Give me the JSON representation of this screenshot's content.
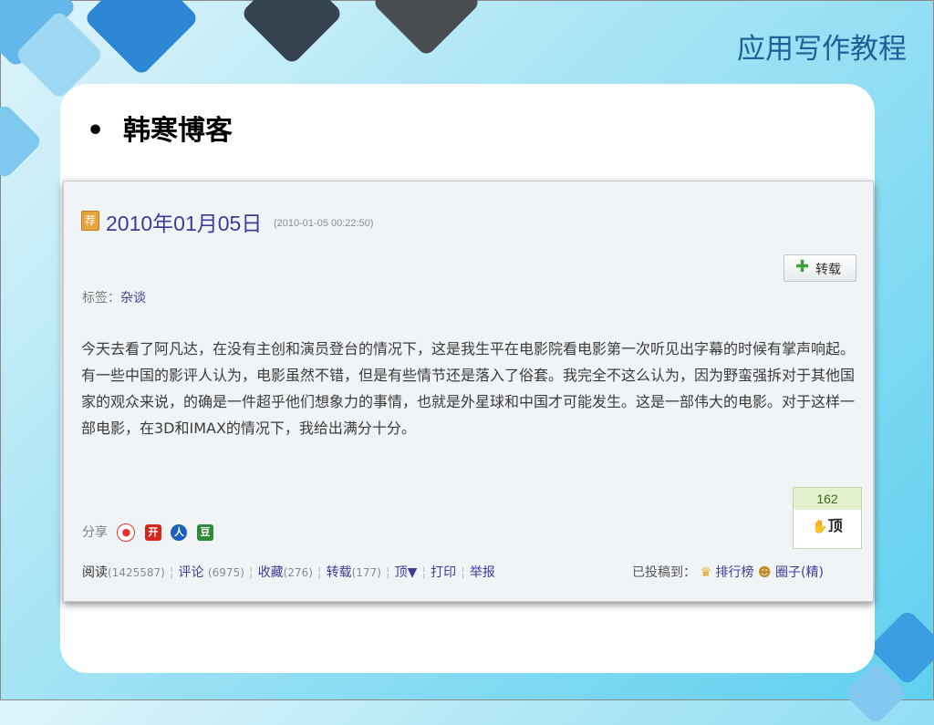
{
  "slide": {
    "course_title": "应用写作教程",
    "bullet_symbol": "•",
    "bullet_text": "韩寒博客"
  },
  "blog": {
    "badge": "荐",
    "date_title": "2010年01月05日",
    "datetime": "(2010-01-05 00:22:50)",
    "repost_button": "转载",
    "tags_label": "标签：",
    "tag": "杂谈",
    "body": "今天去看了阿凡达，在没有主创和演员登台的情况下，这是我生平在电影院看电影第一次听见出字幕的时候有掌声响起。有一些中国的影评人认为，电影虽然不错，但是有些情节还是落入了俗套。我完全不这么认为，因为野蛮强拆对于其他国家的观众来说，的确是一件超乎他们想象力的事情，也就是外星球和中国才可能发生。这是一部伟大的电影。对于这样一部电影，在3D和IMAX的情况下，我给出满分十分。",
    "share_label": "分享",
    "share_icons": [
      "weibo-icon",
      "kaixin-icon",
      "renren-icon",
      "douban-icon"
    ],
    "like_count": "162",
    "like_label": "顶",
    "stats": {
      "read_label": "阅读",
      "read_count": "(1425587)",
      "comment_label": "评论",
      "comment_count": "(6975)",
      "fav_label": "收藏",
      "fav_count": "(276)",
      "repost_label": "转载",
      "repost_count": "(177)",
      "ding_label": "顶▼",
      "print_label": "打印",
      "report_label": "举报",
      "sep": "¦"
    },
    "submitted_label": "已投稿到：",
    "ranking_label": "排行榜",
    "circle_label": "圈子(精)"
  },
  "colors": {
    "title_blue": "#1f5f9a",
    "link_purple": "#43379a",
    "background_cyan": "#5fd0ef"
  }
}
